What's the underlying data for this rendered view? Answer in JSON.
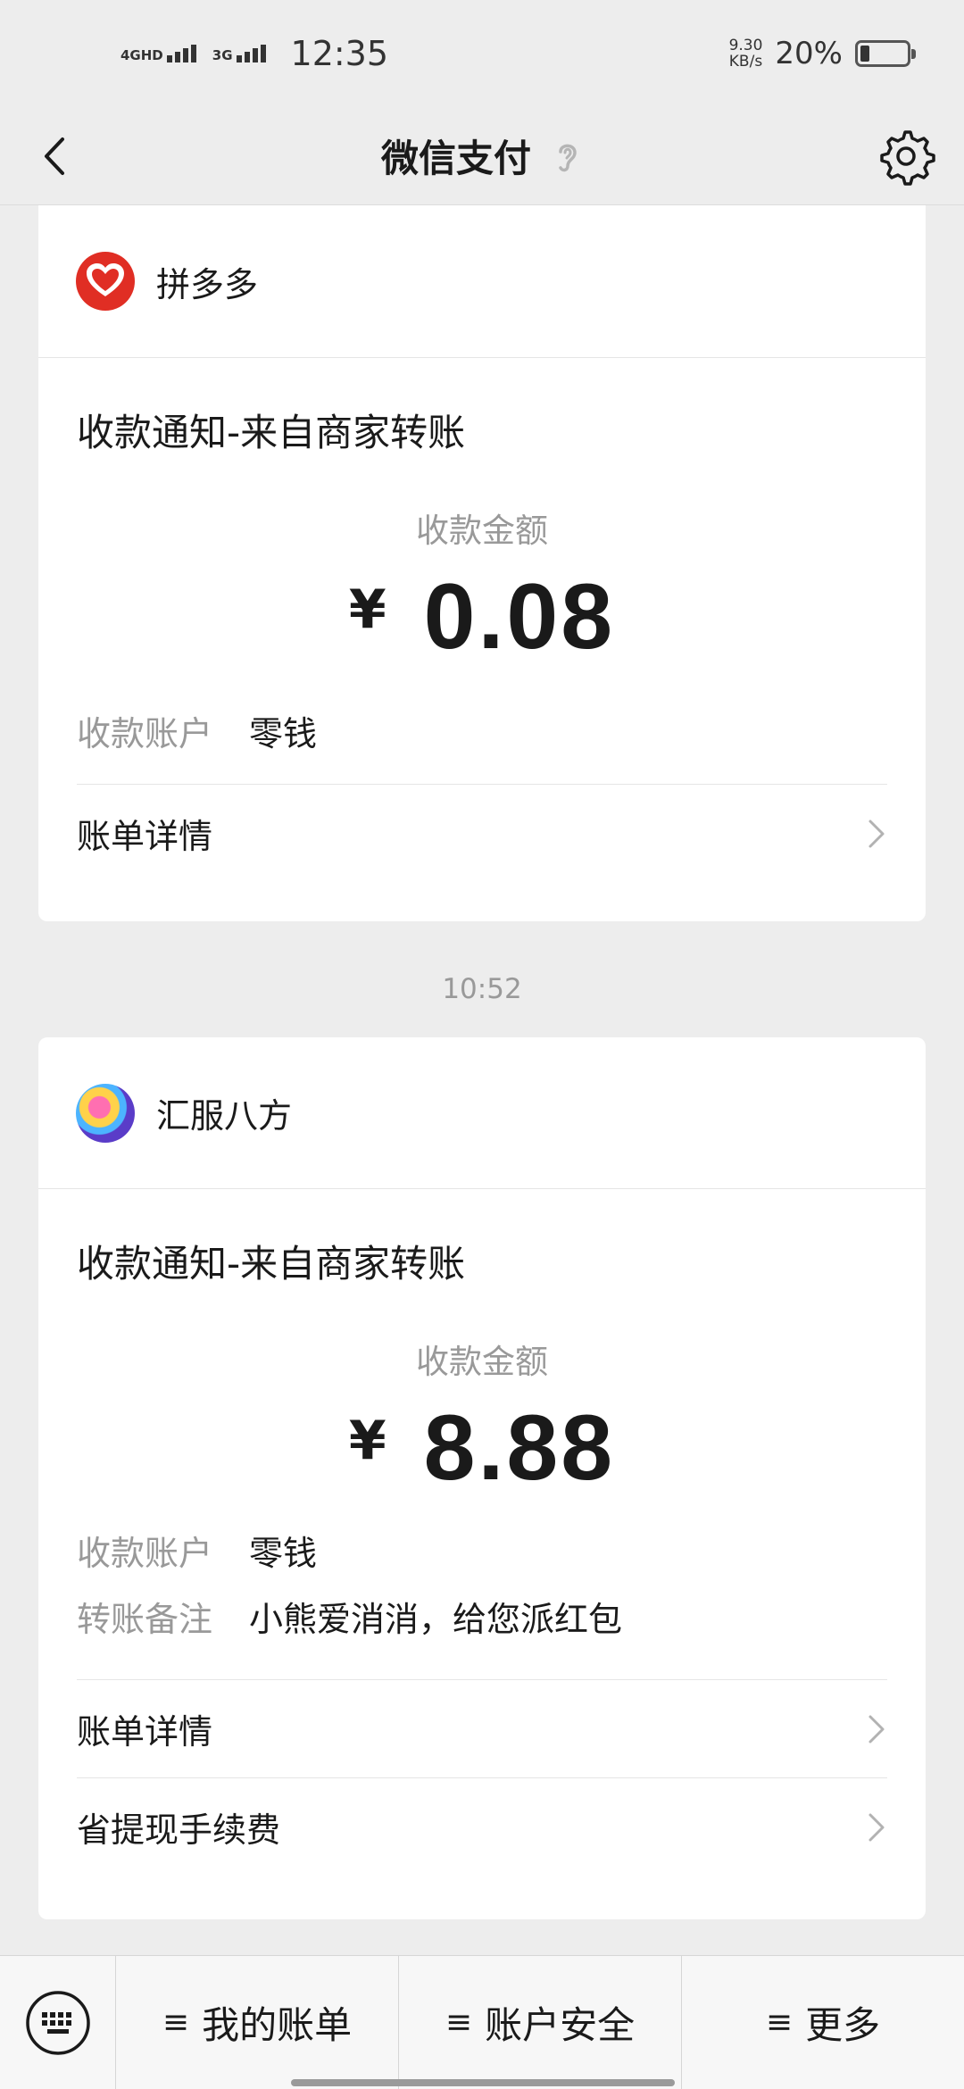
{
  "status_bar": {
    "network1": "4GHD",
    "network2": "3G",
    "time": "12:35",
    "speed_value": "9.30",
    "speed_unit": "KB/s",
    "battery_percent": "20%",
    "battery_level": 0.2
  },
  "nav": {
    "title": "微信支付"
  },
  "messages": [
    {
      "merchant": "拼多多",
      "title": "收款通知-来自商家转账",
      "amount_label": "收款金额",
      "currency": "¥",
      "amount": "0.08",
      "account_label": "收款账户",
      "account_value": "零钱",
      "link_label": "账单详情"
    },
    {
      "merchant": "汇服八方",
      "title": "收款通知-来自商家转账",
      "amount_label": "收款金额",
      "currency": "¥",
      "amount": "8.88",
      "account_label": "收款账户",
      "account_value": "零钱",
      "remark_label": "转账备注",
      "remark_value": "小熊爱消消，给您派红包",
      "link_label": "账单详情",
      "link2_label": "省提现手续费"
    }
  ],
  "time_separator": "10:52",
  "bottom_menu": {
    "hamburger": "≡",
    "items": [
      "我的账单",
      "账户安全",
      "更多"
    ]
  }
}
